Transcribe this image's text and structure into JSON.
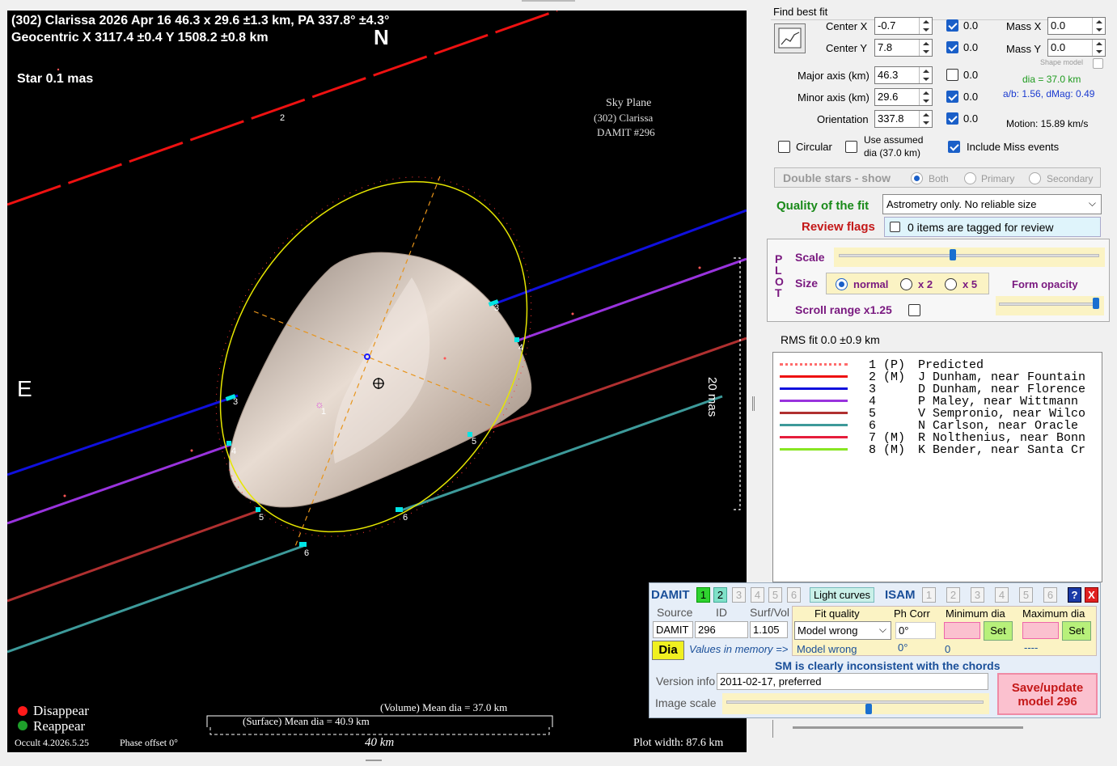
{
  "plot": {
    "title_line1": "(302) Clarissa  2026 Apr 16  46.3 x 29.6 ±1.3 km, PA 337.8° ±4.3°",
    "title_line2": "Geocentric  X  3117.4 ±0.4  Y  1508.2 ±0.8 km",
    "north": "N",
    "east": "E",
    "star": "Star 0.1 mas",
    "sky_plane_1": "Sky Plane",
    "sky_plane_2": "(302) Clarissa",
    "sky_plane_3": "DAMIT #296",
    "scale_mas": "20 mas",
    "volume_dia": "(Volume) Mean dia = 37.0 km",
    "surface_dia": "(Surface) Mean dia = 40.9 km",
    "km_scale": "40 km",
    "plot_width": "Plot width: 87.6 km",
    "disappear": "Disappear",
    "reappear": "Reappear",
    "version": "Occult 4.2026.5.25",
    "phase_offset": "Phase offset 0°",
    "chord_labels": [
      "1",
      "2",
      "3",
      "4",
      "5",
      "6"
    ],
    "colors": {
      "disappear": "#ff1a1a",
      "reappear": "#1e9e2a",
      "ellipse": "#e6e600",
      "axes": "#e8941a",
      "marker": "#00e5e5"
    }
  },
  "fit": {
    "header": "Find best fit",
    "center_x_label": "Center X",
    "center_x": "-0.7",
    "center_x_unc": "0.0",
    "center_y_label": "Center Y",
    "center_y": "7.8",
    "center_y_unc": "0.0",
    "major_label": "Major axis (km)",
    "major": "46.3",
    "major_unc": "0.0",
    "minor_label": "Minor axis (km)",
    "minor": "29.6",
    "minor_unc": "0.0",
    "orient_label": "Orientation",
    "orient": "337.8",
    "orient_unc": "0.0",
    "mass_x_label": "Mass X",
    "mass_x": "0.0",
    "mass_y_label": "Mass Y",
    "mass_y": "0.0",
    "shape_model_label": "Shape model",
    "dia": "dia = 37.0 km",
    "ab": "a/b: 1.56, dMag: 0.49",
    "motion": "Motion: 15.89 km/s",
    "circular": "Circular",
    "assumed_1": "Use assumed",
    "assumed_2": "dia (37.0 km)",
    "miss": "Include Miss events",
    "double_stars": "Double stars - show",
    "both": "Both",
    "primary": "Primary",
    "secondary": "Secondary",
    "quality_label": "Quality of the fit",
    "quality_value": "Astrometry only. No reliable size",
    "review_label": "Review flags",
    "review_value": "0 items are tagged for review"
  },
  "plotctl": {
    "side": [
      "P",
      "L",
      "O",
      "T"
    ],
    "scale": "Scale",
    "size": "Size",
    "normal": "normal",
    "x2": "x 2",
    "x5": "x 5",
    "form_opacity": "Form opacity",
    "scroll_range": "Scroll range x1.25"
  },
  "rms": "RMS fit 0.0 ±0.9 km",
  "legend": [
    {
      "num": "1",
      "tag": "(P)",
      "name": "Predicted",
      "color": "#ff6b6b",
      "style": "dotted"
    },
    {
      "num": "2",
      "tag": "(M)",
      "name": "J Dunham, near Fountain",
      "color": "#ee1111",
      "style": "solid"
    },
    {
      "num": "3",
      "tag": "",
      "name": "D Dunham, near Florence",
      "color": "#1010dd",
      "style": "solid"
    },
    {
      "num": "4",
      "tag": "",
      "name": "P Maley, near Wittmann",
      "color": "#9933dd",
      "style": "solid"
    },
    {
      "num": "5",
      "tag": "",
      "name": "V Sempronio, near Wilco",
      "color": "#b03030",
      "style": "solid"
    },
    {
      "num": "6",
      "tag": "",
      "name": "N Carlson, near Oracle",
      "color": "#3d9a9a",
      "style": "solid"
    },
    {
      "num": "7",
      "tag": "(M)",
      "name": "R Nolthenius, near Bonn",
      "color": "#e61e3c",
      "style": "solid"
    },
    {
      "num": "8",
      "tag": "(M)",
      "name": "K Bender, near Santa Cr",
      "color": "#88e622",
      "style": "solid"
    }
  ],
  "damit": {
    "damit_label": "DAMIT",
    "nums": [
      "1",
      "2",
      "3",
      "4",
      "5",
      "6"
    ],
    "light_curves": "Light curves",
    "isam_label": "ISAM",
    "help": "?",
    "close": "X",
    "source_label": "Source",
    "id_label": "ID",
    "surfvol_label": "Surf/Vol",
    "source": "DAMIT",
    "id": "296",
    "surfvol": "1.105",
    "fit_quality_label": "Fit quality",
    "phcorr_label": "Ph Corr",
    "min_dia_label": "Minimum dia",
    "max_dia_label": "Maximum dia",
    "fit_quality": "Model wrong",
    "phcorr": "0°",
    "set": "Set",
    "dia_btn": "Dia",
    "values_in_memory": "Values in memory =>",
    "mem_fit": "Model wrong",
    "mem_ph": "0°",
    "mem_min": "0",
    "mem_max": "----",
    "warning": "SM is clearly inconsistent with the chords",
    "version_label": "Version info",
    "version": "2011-02-17, preferred",
    "image_scale_label": "Image scale",
    "save_1": "Save/update",
    "save_2": "model 296"
  }
}
